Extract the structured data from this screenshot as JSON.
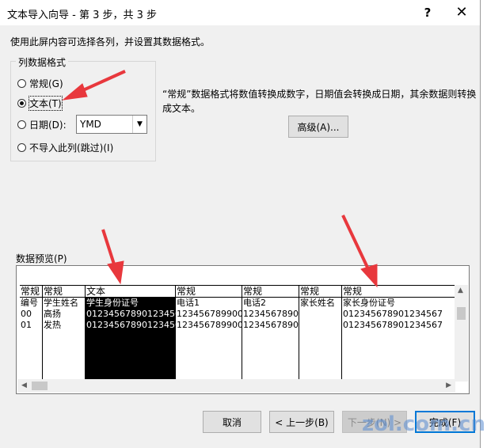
{
  "titlebar": {
    "title": "文本导入向导 - 第 3 步，共 3 步",
    "help": "?",
    "close": "✕"
  },
  "instruction": "使用此屏内容可选择各列，并设置其数据格式。",
  "column_format": {
    "group_title": "列数据格式",
    "options": [
      {
        "label": "常规(G)",
        "selected": false
      },
      {
        "label": "文本(T)",
        "selected": true
      },
      {
        "label": "日期(D):",
        "selected": false
      },
      {
        "label": "不导入此列(跳过)(I)",
        "selected": false
      }
    ],
    "date_format": "YMD"
  },
  "description": "“常规”数据格式将数值转换成数字，日期值会转换成日期，其余数据则转换成文本。",
  "advanced_button": "高级(A)...",
  "preview": {
    "label": "数据预览(P)",
    "columns": [
      {
        "header": "常规",
        "rows": [
          "编号",
          "00",
          "01"
        ]
      },
      {
        "header": "常规",
        "rows": [
          "学生姓名",
          "高扬",
          "发热"
        ]
      },
      {
        "header": "文本",
        "rows": [
          "学生身份证号",
          "012345678901234567",
          "012345678901234567"
        ]
      },
      {
        "header": "常规",
        "rows": [
          "电话1",
          "1234567899000",
          "1234567899000"
        ]
      },
      {
        "header": "常规",
        "rows": [
          "电话2",
          "12345678901",
          "12345678901"
        ]
      },
      {
        "header": "常规",
        "rows": [
          "家长姓名",
          "",
          ""
        ]
      },
      {
        "header": "常规",
        "rows": [
          "家长身份证号",
          "012345678901234567",
          "012345678901234567"
        ]
      }
    ]
  },
  "buttons": {
    "cancel": "取消",
    "back": "< 上一步(B)",
    "next": "下一步(N) >",
    "finish": "完成(F)"
  },
  "watermark": "zol.com.cn",
  "colors": {
    "annotation_arrow": "#e8383d",
    "focus_border": "#0078d7"
  }
}
